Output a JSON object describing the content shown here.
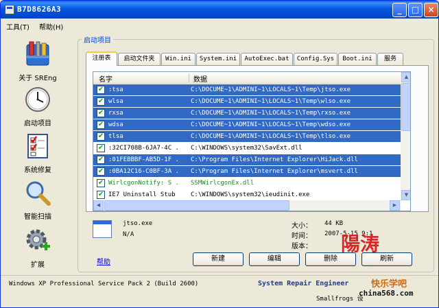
{
  "window": {
    "title": "B7D8626A3",
    "min_label": "_",
    "max_label": "□",
    "close_label": "×"
  },
  "menu": {
    "tools": "工具(T)",
    "help": "帮助(H)"
  },
  "sidebar": {
    "items": [
      {
        "label": "关于 SREng",
        "icon": "toolbox-icon"
      },
      {
        "label": "启动项目",
        "icon": "clock-icon"
      },
      {
        "label": "系统修复",
        "icon": "checklist-icon"
      },
      {
        "label": "智能扫描",
        "icon": "magnifier-icon"
      },
      {
        "label": "扩展",
        "icon": "gear-plus-icon"
      }
    ]
  },
  "group": {
    "legend": "启动项目"
  },
  "tabs": [
    {
      "label": "注册表",
      "active": true
    },
    {
      "label": "启动文件夹",
      "active": false
    },
    {
      "label": "Win.ini",
      "active": false
    },
    {
      "label": "System.ini",
      "active": false
    },
    {
      "label": "AutoExec.bat",
      "active": false
    },
    {
      "label": "Config.Sys",
      "active": false
    },
    {
      "label": "Boot.ini",
      "active": false
    },
    {
      "label": "服务",
      "active": false
    }
  ],
  "list": {
    "columns": [
      "名字",
      "数据"
    ],
    "rows": [
      {
        "name": ":tsa",
        "data": "C:\\DOCUME~1\\ADMINI~1\\LOCALS~1\\Temp\\jtso.exe",
        "selected": true,
        "green": false
      },
      {
        "name": "wlsa",
        "data": "C:\\DOCUME~1\\ADMINI~1\\LOCALS~1\\Temp\\wlso.exe",
        "selected": true,
        "green": false
      },
      {
        "name": "rxsa",
        "data": "C:\\DOCUME~1\\ADMINI~1\\LOCALS~1\\Temp\\rxso.exe",
        "selected": true,
        "green": false
      },
      {
        "name": "wdsa",
        "data": "C:\\DOCUME~1\\ADMINI~1\\LOCALS~1\\Temp\\wdso.exe",
        "selected": true,
        "green": false
      },
      {
        "name": "tlsa",
        "data": "C:\\DOCUME~1\\ADMINI~1\\LOCALS~1\\Temp\\tlso.exe",
        "selected": true,
        "green": false
      },
      {
        "name": ":32CI708B-6JA7-4C .",
        "data": "C:\\WINDOWS\\system32\\SavExt.dll",
        "selected": false,
        "green": false
      },
      {
        "name": ":01FEBBBF-AB5D-1F .",
        "data": "C:\\Program Files\\Internet Explorer\\HiJack.dll",
        "selected": true,
        "green": false
      },
      {
        "name": ":0BA12C16-C0BF-3A .",
        "data": "C:\\Program Files\\Internet Explorer\\msvert.dll",
        "selected": true,
        "green": false
      },
      {
        "name": "WirlcgonNotify: S .",
        "data": "SSMWirlcgonEx.dll",
        "selected": false,
        "green": true
      },
      {
        "name": "IE7 Uninstall Stub",
        "data": "C:\\WINDOWS\\system32\\ieudinit.exe",
        "selected": false,
        "green": false
      }
    ]
  },
  "info": {
    "filename": "jtso.exe",
    "company": "N/A",
    "size_label": "大小：",
    "size_value": "44 KB",
    "time_label": "时间：",
    "time_value": "2007-5-15 9:1",
    "version_label": "版本："
  },
  "help_link": "帮助",
  "buttons": {
    "new": "新建",
    "edit": "编辑",
    "delete": "删除",
    "refresh": "刷新"
  },
  "status": {
    "os": "Windows XP Professional Service Pack 2 (Build 2600)",
    "app": "System Repair Engineer",
    "author": "Smallfrogs 设"
  },
  "watermark": {
    "line1": "陽涛",
    "line2": "快乐学吧",
    "line3": "china568.com"
  },
  "colors": {
    "titlebar": "#0556e0",
    "selection": "#316ac5",
    "link": "#0000ee",
    "legend": "#0046d5"
  }
}
